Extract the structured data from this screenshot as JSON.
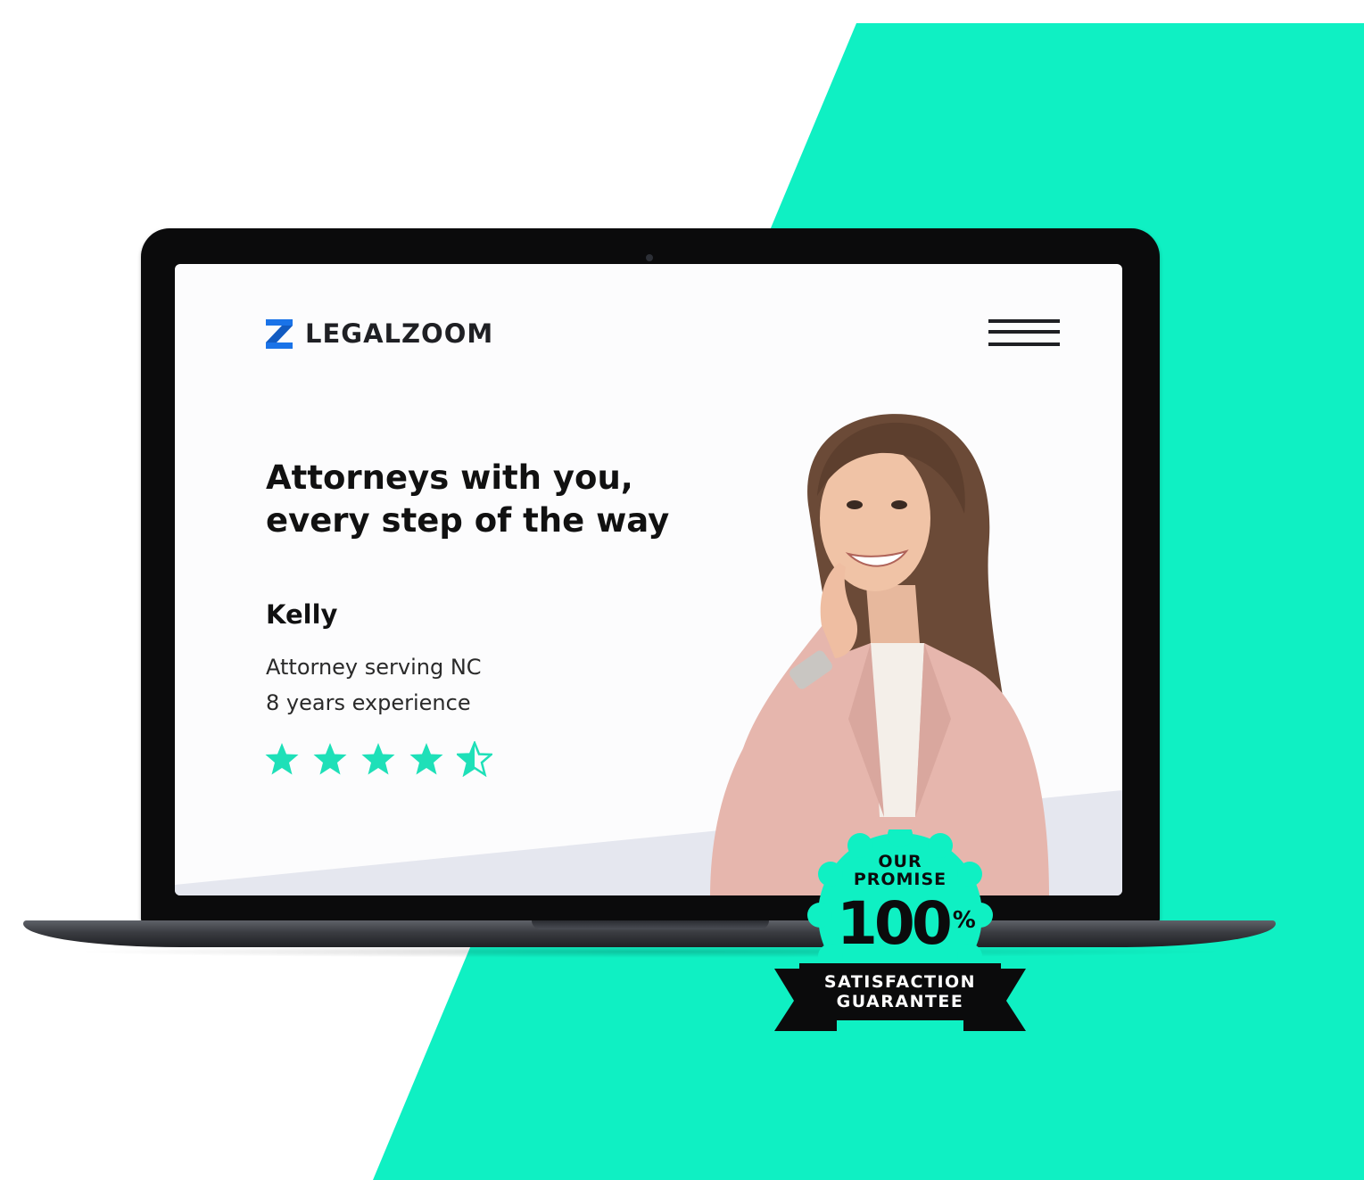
{
  "colors": {
    "accent": "#0ff0c3",
    "brand_blue": "#1a73e8",
    "text": "#111111"
  },
  "site": {
    "logo_text": "LEGALZOOM",
    "logo_icon": "legalzoom-z-logo",
    "menu_icon": "hamburger-menu-icon",
    "headline_line1": "Attorneys with you,",
    "headline_line2": "every step of the way"
  },
  "attorney": {
    "name": "Kelly",
    "role": "Attorney serving NC",
    "experience": "8 years experience",
    "rating": 4.5,
    "rating_max": 5
  },
  "badge": {
    "line_our": "OUR",
    "line_promise": "PROMISE",
    "percent_value": "100",
    "percent_sign": "%",
    "ribbon_line1": "SATISFACTION",
    "ribbon_line2": "GUARANTEE"
  }
}
